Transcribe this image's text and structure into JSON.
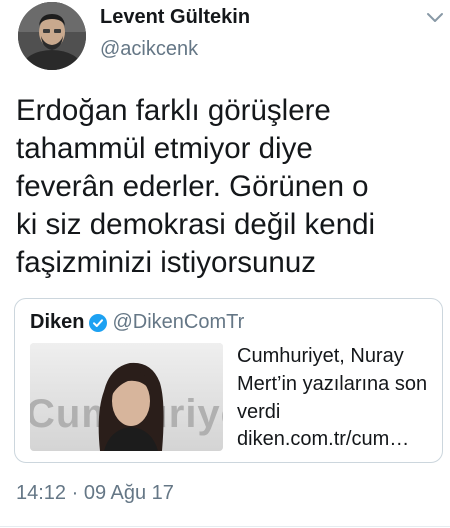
{
  "author": {
    "display_name": "Levent Gültekin",
    "handle": "@acikcenk",
    "avatar_icon": "profile-photo"
  },
  "tweet": {
    "text": "Erdoğan farklı görüşlere\ntahammül etmiyor diye\nfeverân ederler. Görünen o\nki siz demokrasi değil kendi\nfaşizminizi istiyorsunuz",
    "timestamp": "14:12 · 09 Ağu 17"
  },
  "quoted_card": {
    "name": "Diken",
    "verified": true,
    "handle": "@DikenComTr",
    "title": "Cumhuriyet, Nuray Mert’in yazılarına son verdi",
    "url": "diken.com.tr/cum…",
    "image_logo_text": "Cumhuriyet"
  },
  "icons": {
    "caret": "chevron-down-icon",
    "verified": "verified-badge-icon"
  },
  "colors": {
    "primary_text": "#14171a",
    "secondary_text": "#657786",
    "verified_blue": "#1da1f2",
    "border": "#ccd6dd"
  }
}
